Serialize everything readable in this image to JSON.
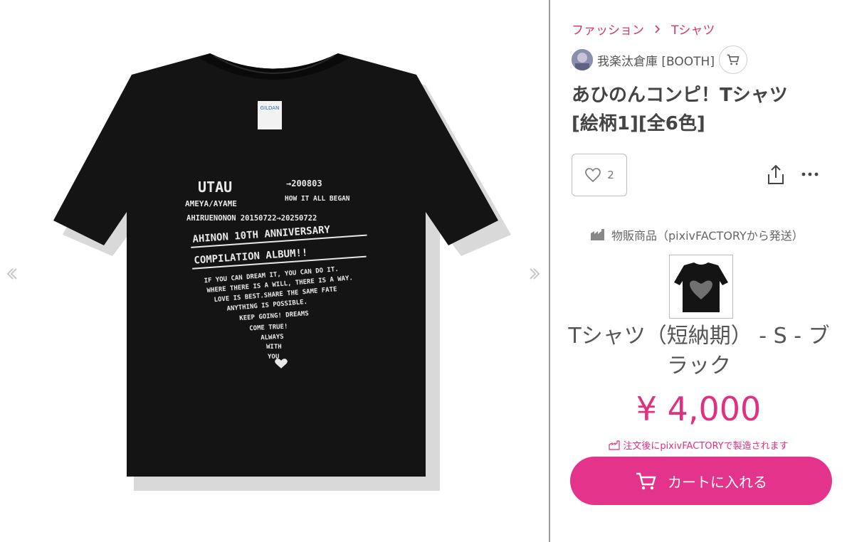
{
  "breadcrumb": {
    "category": "ファッション",
    "subcategory": "Tシャツ"
  },
  "shop": {
    "name": "我楽汰倉庫 [BOOTH]"
  },
  "product": {
    "title_line1": "あひのんコンピ！Tシャツ",
    "title_line2": "[絵柄1][全6色]",
    "likes": "2",
    "shipping_type": "物販商品（pixivFACTORYから発送）",
    "variant_line1": "Tシャツ（短納期） - S - ブ",
    "variant_line2": "ラック",
    "price": "¥ 4,000",
    "factory_note": "注文後にpixivFACTORYで製造されます",
    "cart_label": "カートに入れる"
  },
  "shirt_print": {
    "utau": "UTAU",
    "ameya": "AMEYA/AYAME",
    "date1": "→200803",
    "began": "HOW IT ALL BEGAN",
    "date2": "AHIRUENONON 20150722→20250722",
    "anniv": "AHINON 10TH ANNIVERSARY",
    "album": "COMPILATION ALBUM!!",
    "l1": "IF YOU CAN DREAM IT, YOU CAN DO IT.",
    "l2": "WHERE THERE IS A WILL, THERE IS A WAY.",
    "l3": "LOVE IS BEST.SHARE THE SAME FATE",
    "l4": "ANYTHING IS POSSIBLE.",
    "l5": "KEEP GOING! DREAMS",
    "l6": "COME TRUE!",
    "l7": "ALWAYS",
    "l8": "WITH",
    "l9": "YOU",
    "tag_brand": "GILDAN"
  },
  "colors": {
    "accent": "#e4338b",
    "price": "#e0307f",
    "breadcrumb": "#d6336c",
    "shirt": "#141414"
  },
  "icons": [
    "chevron-left-icon",
    "chevron-right-icon",
    "cart-icon",
    "heart-icon",
    "share-icon",
    "more-icon",
    "factory-icon"
  ]
}
